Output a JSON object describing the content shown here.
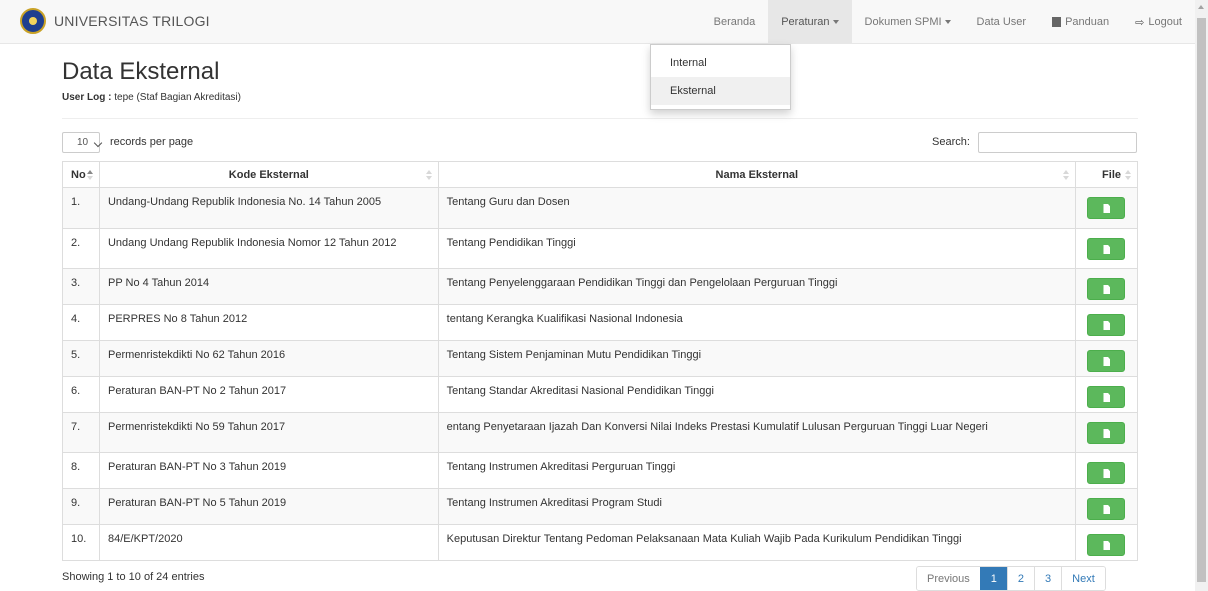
{
  "app": {
    "brand": "UNIVERSITAS TRILOGI"
  },
  "nav": {
    "items": [
      {
        "label": "Beranda"
      },
      {
        "label": "Peraturan"
      },
      {
        "label": "Dokumen SPMI"
      },
      {
        "label": "Data User"
      },
      {
        "label": "Panduan"
      },
      {
        "label": "Logout"
      }
    ],
    "dropdown": [
      "Internal",
      "Eksternal"
    ]
  },
  "page": {
    "title": "Data Eksternal",
    "user_log_label": "User Log :",
    "user_log_value": "tepe (Staf Bagian Akreditasi)"
  },
  "controls": {
    "page_length": "10",
    "length_label": "records per page",
    "search_label": "Search:"
  },
  "table": {
    "headers": [
      "No",
      "Kode Eksternal",
      "Nama Eksternal",
      "File"
    ],
    "rows": [
      {
        "no": "1.",
        "kode": "Undang-Undang Republik Indonesia No. 14 Tahun 2005",
        "nama": "Tentang Guru dan Dosen"
      },
      {
        "no": "2.",
        "kode": "Undang Undang Republik Indonesia Nomor 12 Tahun 2012",
        "nama": "Tentang Pendidikan Tinggi"
      },
      {
        "no": "3.",
        "kode": "PP No 4 Tahun 2014",
        "nama": "Tentang Penyelenggaraan Pendidikan Tinggi dan Pengelolaan Perguruan Tinggi"
      },
      {
        "no": "4.",
        "kode": "PERPRES No 8 Tahun 2012",
        "nama": "tentang Kerangka Kualifikasi Nasional Indonesia"
      },
      {
        "no": "5.",
        "kode": "Permenristekdikti No 62 Tahun 2016",
        "nama": "Tentang Sistem Penjaminan Mutu Pendidikan Tinggi"
      },
      {
        "no": "6.",
        "kode": "Peraturan BAN-PT No 2 Tahun 2017",
        "nama": "Tentang Standar Akreditasi Nasional Pendidikan Tinggi"
      },
      {
        "no": "7.",
        "kode": "Permenristekdikti No 59 Tahun 2017",
        "nama": "entang Penyetaraan Ijazah Dan Konversi Nilai Indeks Prestasi Kumulatif Lulusan Perguruan Tinggi Luar Negeri"
      },
      {
        "no": "8.",
        "kode": "Peraturan BAN-PT No 3 Tahun 2019",
        "nama": "Tentang Instrumen Akreditasi Perguruan Tinggi"
      },
      {
        "no": "9.",
        "kode": "Peraturan BAN-PT No 5 Tahun 2019",
        "nama": "Tentang Instrumen Akreditasi Program Studi"
      },
      {
        "no": "10.",
        "kode": "84/E/KPT/2020",
        "nama": "Keputusan Direktur Tentang Pedoman Pelaksanaan Mata Kuliah Wajib Pada Kurikulum Pendidikan Tinggi"
      }
    ]
  },
  "footer": {
    "info": "Showing 1 to 10 of 24 entries",
    "pagination": [
      "Previous",
      "1",
      "2",
      "3",
      "Next"
    ]
  },
  "colors": {
    "file_button": "#5cb85c",
    "pager_active": "#337ab7"
  }
}
